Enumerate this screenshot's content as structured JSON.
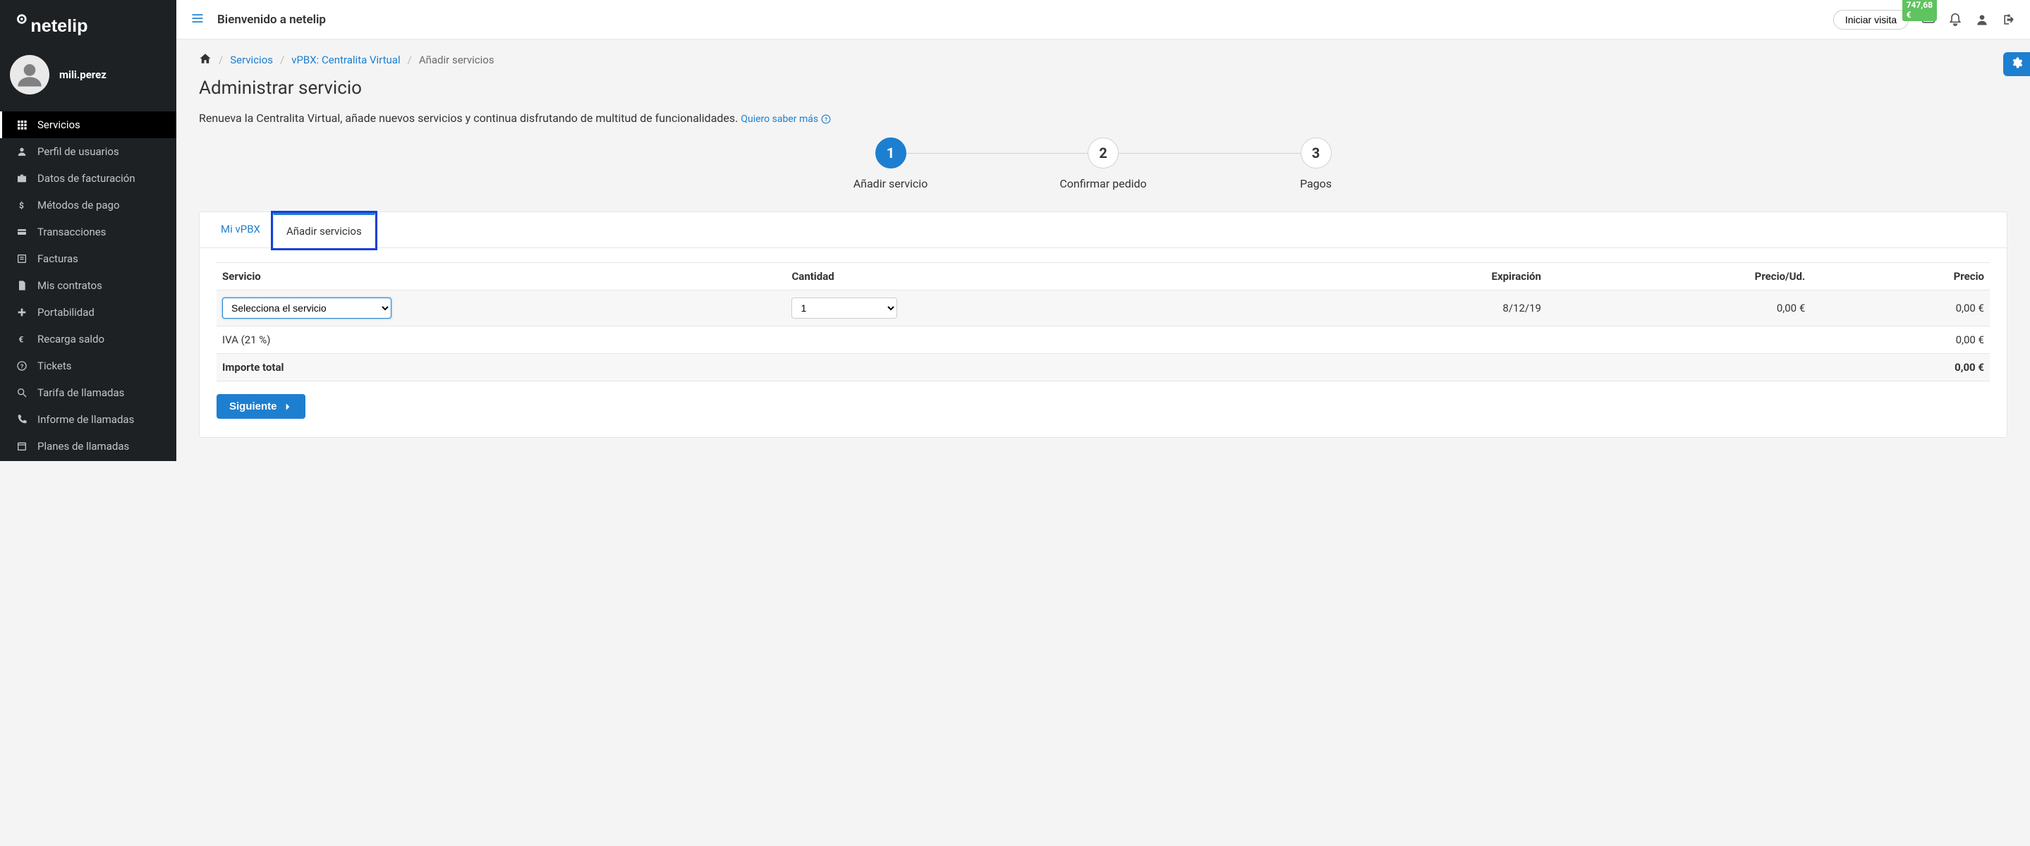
{
  "brand": "netelip",
  "user": {
    "name": "mili.perez"
  },
  "sidebar": {
    "items": [
      {
        "label": "Servicios",
        "icon": "grid"
      },
      {
        "label": "Perfil de usuarios",
        "icon": "user"
      },
      {
        "label": "Datos de facturación",
        "icon": "briefcase"
      },
      {
        "label": "Métodos de pago",
        "icon": "dollar"
      },
      {
        "label": "Transacciones",
        "icon": "card"
      },
      {
        "label": "Facturas",
        "icon": "list"
      },
      {
        "label": "Mis contratos",
        "icon": "file"
      },
      {
        "label": "Portabilidad",
        "icon": "plus"
      },
      {
        "label": "Recarga saldo",
        "icon": "euro"
      },
      {
        "label": "Tickets",
        "icon": "help"
      },
      {
        "label": "Tarifa de llamadas",
        "icon": "search"
      },
      {
        "label": "Informe de llamadas",
        "icon": "phone"
      },
      {
        "label": "Planes de llamadas",
        "icon": "calendar"
      }
    ]
  },
  "topbar": {
    "welcome": "Bienvenido a netelip",
    "start_visit": "Iniciar visita",
    "balance": "747,68 €"
  },
  "breadcrumb": {
    "items": [
      "Servicios",
      "vPBX: Centralita Virtual",
      "Añadir servicios"
    ]
  },
  "page": {
    "title": "Administrar servicio",
    "intro": "Renueva la Centralita Virtual, añade nuevos servicios y continua disfrutando de multitud de funcionalidades.",
    "more": "Quiero saber más"
  },
  "steps": [
    {
      "num": "1",
      "label": "Añadir servicio"
    },
    {
      "num": "2",
      "label": "Confirmar pedido"
    },
    {
      "num": "3",
      "label": "Pagos"
    }
  ],
  "tabs": {
    "my_vpbx": "Mi vPBX",
    "add_services": "Añadir servicios"
  },
  "table": {
    "headers": {
      "service": "Servicio",
      "qty": "Cantidad",
      "exp": "Expiración",
      "unit": "Precio/Ud.",
      "price": "Precio"
    },
    "row": {
      "service_placeholder": "Selecciona el servicio",
      "qty_value": "1",
      "exp": "8/12/19",
      "unit": "0,00 €",
      "price": "0,00 €"
    },
    "iva_label": "IVA (21 %)",
    "iva_value": "0,00 €",
    "total_label": "Importe total",
    "total_value": "0,00 €"
  },
  "next_button": "Siguiente"
}
